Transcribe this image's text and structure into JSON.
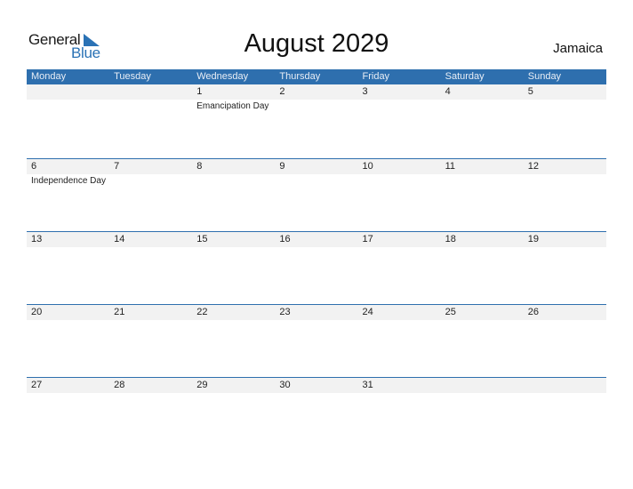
{
  "logo": {
    "word1": "General",
    "word2": "Blue",
    "brand_color": "#2a72b5"
  },
  "title": "August 2029",
  "country": "Jamaica",
  "colors": {
    "header_bg": "#2e6fae",
    "date_strip_bg": "#f2f2f2"
  },
  "weekdays": [
    "Monday",
    "Tuesday",
    "Wednesday",
    "Thursday",
    "Friday",
    "Saturday",
    "Sunday"
  ],
  "weeks": [
    {
      "days": [
        "",
        "",
        "1",
        "2",
        "3",
        "4",
        "5"
      ],
      "events": [
        "",
        "",
        "Emancipation Day",
        "",
        "",
        "",
        ""
      ]
    },
    {
      "days": [
        "6",
        "7",
        "8",
        "9",
        "10",
        "11",
        "12"
      ],
      "events": [
        "Independence Day",
        "",
        "",
        "",
        "",
        "",
        ""
      ]
    },
    {
      "days": [
        "13",
        "14",
        "15",
        "16",
        "17",
        "18",
        "19"
      ],
      "events": [
        "",
        "",
        "",
        "",
        "",
        "",
        ""
      ]
    },
    {
      "days": [
        "20",
        "21",
        "22",
        "23",
        "24",
        "25",
        "26"
      ],
      "events": [
        "",
        "",
        "",
        "",
        "",
        "",
        ""
      ]
    },
    {
      "days": [
        "27",
        "28",
        "29",
        "30",
        "31",
        "",
        ""
      ],
      "events": [
        "",
        "",
        "",
        "",
        "",
        "",
        ""
      ]
    }
  ]
}
